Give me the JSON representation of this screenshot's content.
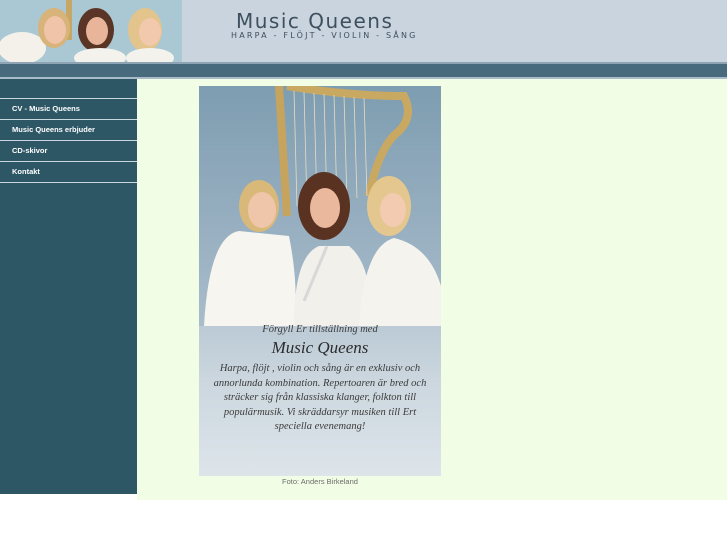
{
  "header": {
    "title": "Music Queens",
    "subtitle": "HARPA - FLÖJT - VIOLIN - SÅNG",
    "background": "#c9d4df"
  },
  "sidebar": {
    "background": "#2e5766",
    "items": [
      {
        "label": "CV - Music Queens"
      },
      {
        "label": "Music Queens erbjuder"
      },
      {
        "label": "CD-skivor"
      },
      {
        "label": "Kontakt"
      }
    ]
  },
  "content": {
    "background": "#f2fde5",
    "poster": {
      "intro": "Förgyll Er tillställning med",
      "name": "Music Queens",
      "description": "Harpa, flöjt , violin och sång är en exklusiv och annorlunda kombination. Repertoaren är bred och sträcker sig från klassiska klanger, folkton till populärmusik. Vi skräddarsyr musiken till Ert speciella evenemang!"
    },
    "caption": "Foto: Anders Birkeland"
  }
}
